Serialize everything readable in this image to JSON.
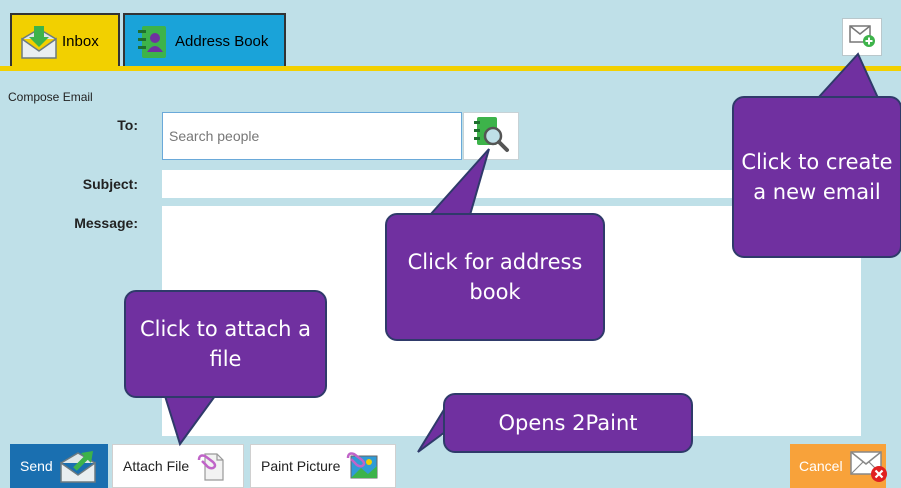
{
  "tabs": [
    {
      "label": "Inbox",
      "icon": "inbox-icon",
      "color": "#f2d000"
    },
    {
      "label": "Address Book",
      "icon": "address-book-icon",
      "color": "#1aa3d9"
    }
  ],
  "header": {
    "new_email_icon": "new-email-icon"
  },
  "compose": {
    "title": "Compose Email",
    "to_label": "To:",
    "to_placeholder": "Search people",
    "to_value": "",
    "subject_label": "Subject:",
    "subject_value": "",
    "message_label": "Message:",
    "message_value": ""
  },
  "buttons": {
    "send": "Send",
    "attach": "Attach File",
    "paint": "Paint Picture",
    "cancel": "Cancel"
  },
  "callouts": {
    "new_email": "Click to create a new email",
    "address_book": "Click for address book",
    "attach": "Click to attach a file",
    "paint": "Opens 2Paint"
  },
  "colors": {
    "background": "#bfe0e8",
    "accent_yellow": "#f2d000",
    "send_blue": "#1a6fb0",
    "cancel_orange": "#f8a23a",
    "callout_purple": "#7030a0"
  }
}
